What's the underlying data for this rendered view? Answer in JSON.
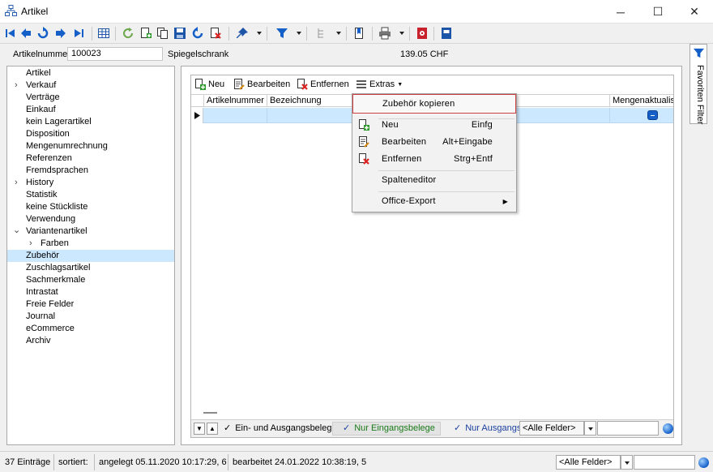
{
  "window": {
    "title": "Artikel"
  },
  "header": {
    "label": "Artikelnummer",
    "number": "100023",
    "name": "Spiegelschrank",
    "price": "139.05  CHF"
  },
  "nav": {
    "items": [
      {
        "label": "Artikel"
      },
      {
        "label": "Verkauf"
      },
      {
        "label": "Verträge"
      },
      {
        "label": "Einkauf"
      },
      {
        "label": "kein Lagerartikel"
      },
      {
        "label": "Disposition"
      },
      {
        "label": "Mengenumrechnung"
      },
      {
        "label": "Referenzen"
      },
      {
        "label": "Fremdsprachen"
      },
      {
        "label": "History"
      },
      {
        "label": "Statistik"
      },
      {
        "label": "keine Stückliste"
      },
      {
        "label": "Verwendung"
      },
      {
        "label": "Variantenartikel"
      },
      {
        "label": "Farben"
      },
      {
        "label": "Zubehör"
      },
      {
        "label": "Zuschlagsartikel"
      },
      {
        "label": "Sachmerkmale"
      },
      {
        "label": "Intrastat"
      },
      {
        "label": "Freie Felder"
      },
      {
        "label": "Journal"
      },
      {
        "label": "eCommerce"
      },
      {
        "label": "Archiv"
      }
    ]
  },
  "grid": {
    "toolbar": {
      "new": "Neu",
      "edit": "Bearbeiten",
      "remove": "Entfernen",
      "extras": "Extras"
    },
    "columns": [
      "Artikelnummer",
      "Bezeichnung",
      "Mengenaktualisie"
    ],
    "filters": [
      "Ein- und Ausgangsbelege",
      "Nur Eingangsbelege",
      "Nur Ausgangs"
    ],
    "field_combo": "<Alle Felder>"
  },
  "menu": {
    "items": [
      {
        "label": "Zubehör kopieren",
        "shortcut": ""
      },
      {
        "label": "Neu",
        "shortcut": "Einfg"
      },
      {
        "label": "Bearbeiten",
        "shortcut": "Alt+Eingabe"
      },
      {
        "label": "Entfernen",
        "shortcut": "Strg+Entf"
      },
      {
        "label": "Spalteneditor",
        "shortcut": ""
      },
      {
        "label": "Office-Export",
        "shortcut": ""
      }
    ]
  },
  "sidebar_right": {
    "label": "Favoriten Filter"
  },
  "status": {
    "count": "37 Einträge",
    "sorted": "sortiert:",
    "created": "angelegt 05.11.2020 10:17:29,  6",
    "edited": "bearbeitet 24.01.2022 10:38:19,  5",
    "field_combo": "<Alle Felder>"
  },
  "colors": {
    "accent_blue": "#1560c8",
    "selection": "#cce8ff",
    "highlight_border": "#d04040",
    "filter_green": "#1a7a1a",
    "filter_blue": "#1a3fa0"
  },
  "icons": [
    "window-icon",
    "first-record-icon",
    "prev-record-icon",
    "undo-icon",
    "next-record-icon",
    "last-record-icon",
    "table-icon",
    "refresh-icon",
    "new-icon",
    "copy-icon",
    "save-icon",
    "redo-icon",
    "delete-icon",
    "pin-icon",
    "filter-icon",
    "tree-icon",
    "bookmark-icon",
    "print-icon",
    "report-icon",
    "notebook-icon"
  ]
}
